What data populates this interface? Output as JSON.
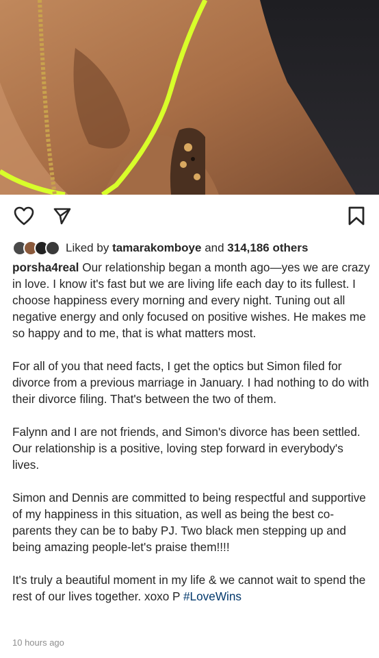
{
  "post": {
    "photo_icon": "photo-image",
    "liked_by_prefix": "Liked by",
    "liked_by_user": "tamarakomboye",
    "liked_by_and": "and",
    "likes_count": "314,186 others",
    "username": "porsha4real",
    "caption_p1": "Our relationship began a month ago—yes we are crazy in love. I know it's fast but we are living life each day to its fullest. I choose happiness every morning and every night. Tuning out all negative energy and only focused on positive wishes. He makes me so happy and to me, that is what matters most.",
    "caption_p2": "For all of you that need facts, I get the optics but Simon filed for divorce from a previous marriage in January. I had nothing to do with their divorce filing. That's between the two of them.",
    "caption_p3": "Falynn and I are not friends, and Simon's divorce has been settled. Our relationship is a positive, loving step forward in everybody's lives.",
    "caption_p4": "Simon and Dennis are committed to being respectful and supportive of my happiness in this situation, as well as being the best co-parents they can be to baby PJ. Two black men stepping up and being amazing people-let's praise them!!!!",
    "caption_p5": "It's truly a beautiful moment in my life & we cannot wait to spend the rest of our lives together. xoxo P",
    "hashtag": "#LoveWins",
    "timestamp": "10 hours ago"
  },
  "icons": {
    "like": "heart-icon",
    "share": "send-icon",
    "save": "bookmark-icon"
  },
  "colors": {
    "text": "#262626",
    "hashtag": "#00376b",
    "muted": "#8e8e8e",
    "strap": "#d8ff2a"
  }
}
